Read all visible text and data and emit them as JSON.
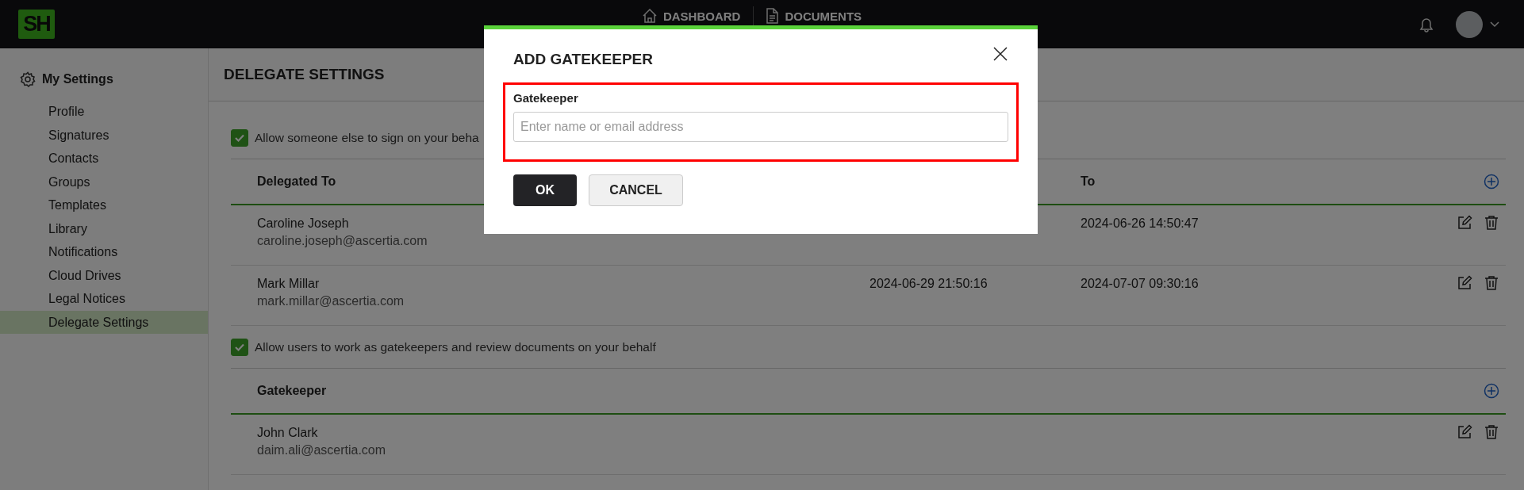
{
  "app": {
    "logo": "SH",
    "nav": [
      {
        "label": "DASHBOARD"
      },
      {
        "label": "DOCUMENTS"
      }
    ]
  },
  "sidebar": {
    "title": "My Settings",
    "items": [
      {
        "label": "Profile",
        "selected": false
      },
      {
        "label": "Signatures",
        "selected": false
      },
      {
        "label": "Contacts",
        "selected": false
      },
      {
        "label": "Groups",
        "selected": false
      },
      {
        "label": "Templates",
        "selected": false
      },
      {
        "label": "Library",
        "selected": false
      },
      {
        "label": "Notifications",
        "selected": false
      },
      {
        "label": "Cloud Drives",
        "selected": false
      },
      {
        "label": "Legal Notices",
        "selected": false
      },
      {
        "label": "Delegate Settings",
        "selected": true
      }
    ]
  },
  "page": {
    "title": "DELEGATE SETTINGS"
  },
  "sections": [
    {
      "checkbox": {
        "label": "Allow someone else to sign on your beha",
        "checked": true
      },
      "columns": {
        "name": "Delegated To",
        "to": "To"
      },
      "rows": [
        {
          "name": "Caroline Joseph",
          "email": "caroline.joseph@ascertia.com",
          "to": "2024-06-26 14:50:47"
        },
        {
          "name": "Mark Millar",
          "email": "mark.millar@ascertia.com",
          "from": "2024-06-29 21:50:16",
          "to": "2024-07-07 09:30:16"
        }
      ]
    },
    {
      "checkbox": {
        "label": "Allow users to work as gatekeepers and review documents on your behalf",
        "checked": true
      },
      "columns": {
        "name": "Gatekeeper"
      },
      "rows": [
        {
          "name": "John Clark",
          "email": "daim.ali@ascertia.com"
        }
      ]
    }
  ],
  "modal": {
    "title": "ADD GATEKEEPER",
    "field": {
      "label": "Gatekeeper",
      "placeholder": "Enter name or email address"
    },
    "buttons": [
      {
        "label": "OK",
        "kind": "primary"
      },
      {
        "label": "CANCEL",
        "kind": "secondary"
      }
    ]
  }
}
